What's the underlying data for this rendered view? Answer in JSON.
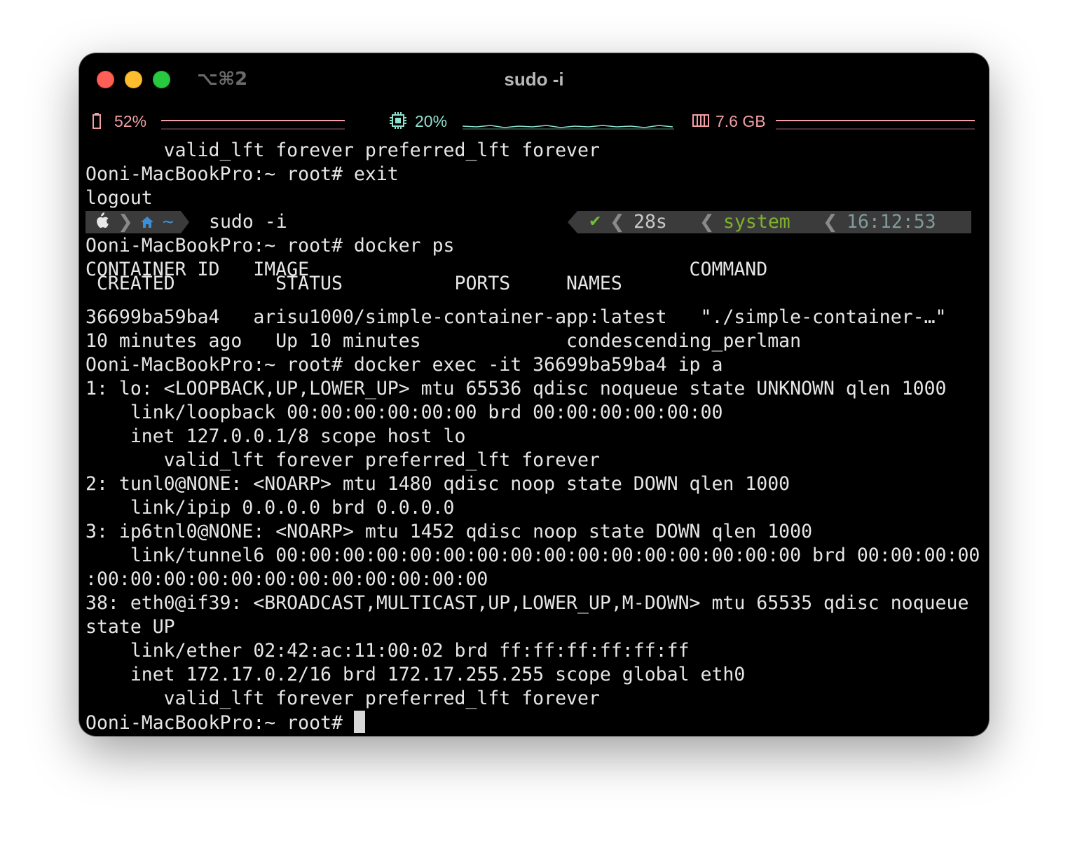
{
  "window": {
    "shortcut": "⌥⌘2",
    "title": "sudo -i"
  },
  "status": {
    "battery_icon": "battery-icon",
    "battery": "52%",
    "cpu_icon": "cpu-chip-icon",
    "cpu": "20%",
    "mem_icon": "memory-icon",
    "mem": "7.6 GB",
    "colors": {
      "battery": "#f2a0a5",
      "cpu": "#8fe0cf",
      "mem": "#f2a0a5"
    }
  },
  "prompt_bar": {
    "apple_icon": "apple-icon",
    "home_icon": "home-icon",
    "path": "~",
    "command": "sudo -i",
    "check": "✔",
    "duration": "28s",
    "hourglass_icon": "hourglass-icon",
    "context": "system",
    "time": "16:12:53",
    "clock_icon": "clock-icon"
  },
  "terminal": {
    "pre_lines": [
      "       valid_lft forever preferred_lft forever",
      "Ooni-MacBookPro:~ root# exit",
      "logout"
    ],
    "post_lines": [
      "Ooni-MacBookPro:~ root# docker ps",
      "CONTAINER ID   IMAGE                                  COMMAND",
      " CREATED         STATUS          PORTS     NAMES",
      "36699ba59ba4   arisu1000/simple-container-app:latest   \"./simple-container-…\"",
      "10 minutes ago   Up 10 minutes             condescending_perlman",
      "Ooni-MacBookPro:~ root# docker exec -it 36699ba59ba4 ip a",
      "1: lo: <LOOPBACK,UP,LOWER_UP> mtu 65536 qdisc noqueue state UNKNOWN qlen 1000",
      "    link/loopback 00:00:00:00:00:00 brd 00:00:00:00:00:00",
      "    inet 127.0.0.1/8 scope host lo",
      "       valid_lft forever preferred_lft forever",
      "2: tunl0@NONE: <NOARP> mtu 1480 qdisc noop state DOWN qlen 1000",
      "    link/ipip 0.0.0.0 brd 0.0.0.0",
      "3: ip6tnl0@NONE: <NOARP> mtu 1452 qdisc noop state DOWN qlen 1000",
      "    link/tunnel6 00:00:00:00:00:00:00:00:00:00:00:00:00:00:00:00 brd 00:00:00:00",
      ":00:00:00:00:00:00:00:00:00:00:00:00",
      "38: eth0@if39: <BROADCAST,MULTICAST,UP,LOWER_UP,M-DOWN> mtu 65535 qdisc noqueue",
      "state UP",
      "    link/ether 02:42:ac:11:00:02 brd ff:ff:ff:ff:ff:ff",
      "    inet 172.17.0.2/16 brd 172.17.255.255 scope global eth0",
      "       valid_lft forever preferred_lft forever"
    ],
    "final_prompt": "Ooni-MacBookPro:~ root# "
  }
}
